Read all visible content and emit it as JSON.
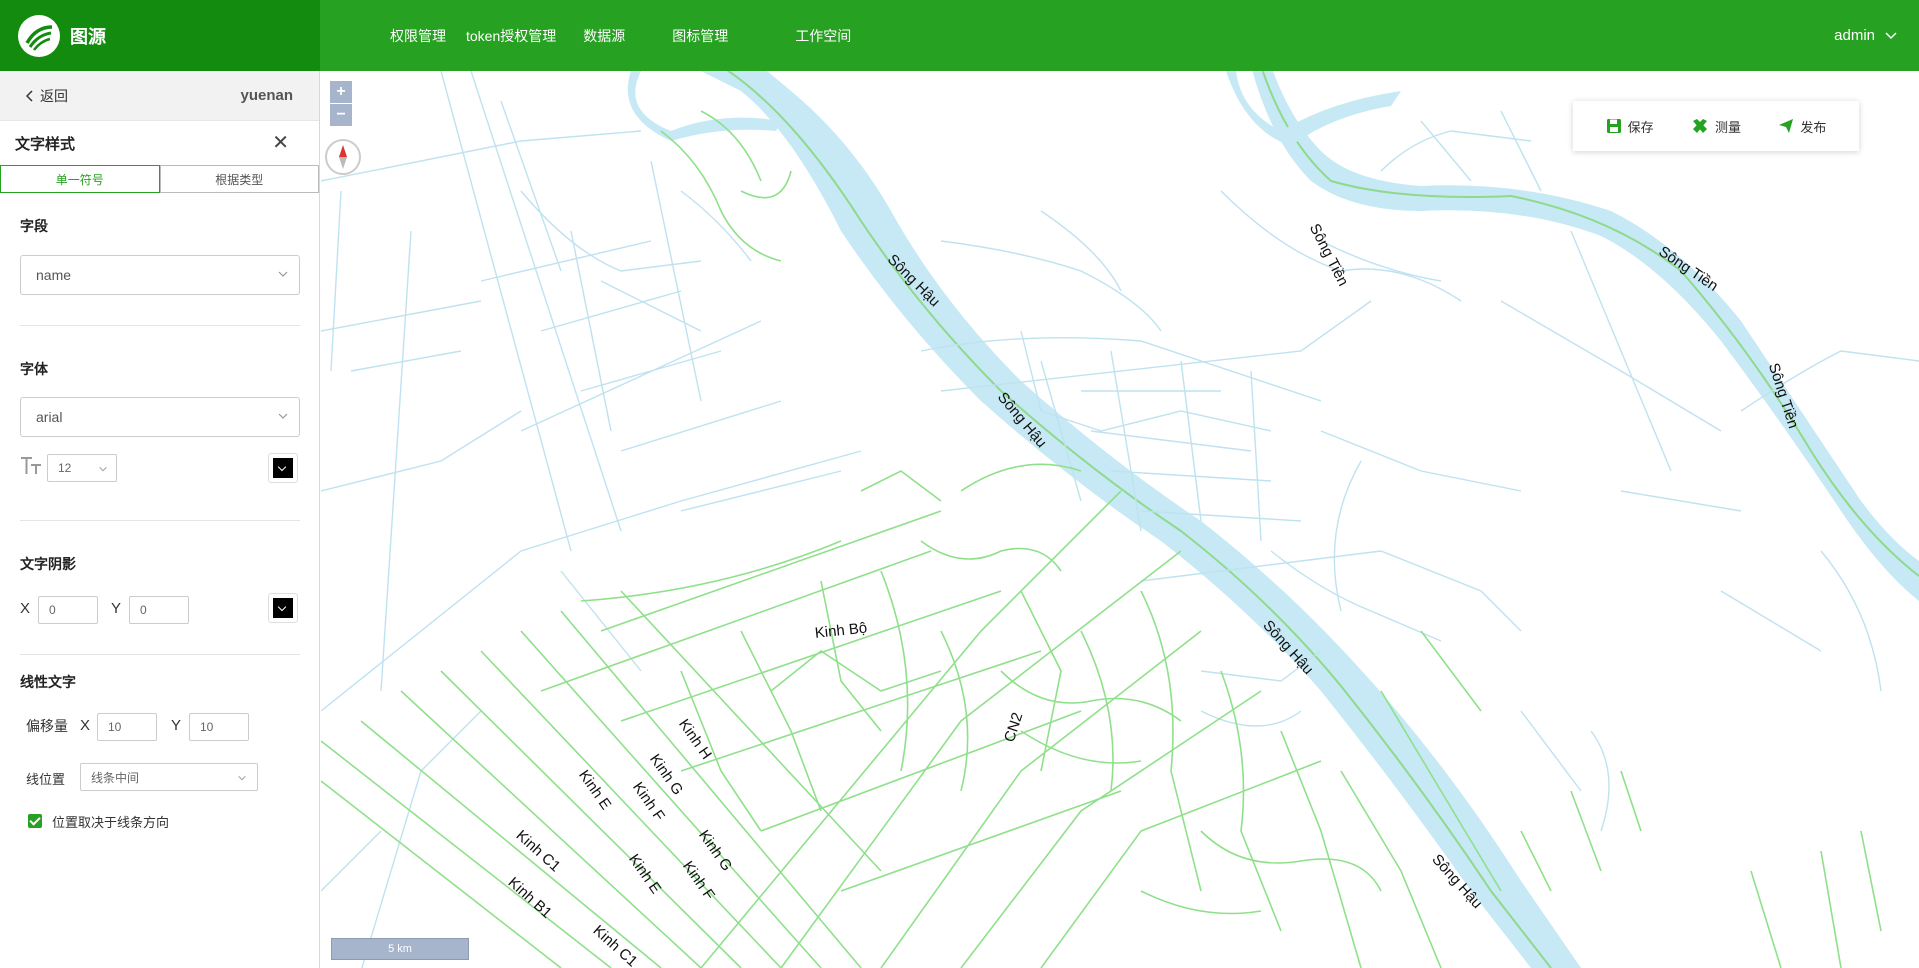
{
  "header": {
    "brand_name": "图源",
    "nav": [
      "权限管理",
      "token授权管理",
      "数据源",
      "图标管理",
      "工作空间"
    ],
    "user": "admin"
  },
  "sidebar": {
    "back_label": "返回",
    "project_name": "yuenan",
    "panel_title": "文字样式",
    "tabs": [
      "单一符号",
      "根据类型"
    ],
    "field": {
      "label": "字段",
      "value": "name"
    },
    "font": {
      "label": "字体",
      "value": "arial",
      "size": "12",
      "color": "#000000"
    },
    "shadow": {
      "label": "文字阴影",
      "x_label": "X",
      "x_value": "0",
      "y_label": "Y",
      "y_value": "0",
      "color": "#000000"
    },
    "linear": {
      "label": "线性文字",
      "offset_label": "偏移量",
      "x_label": "X",
      "x_value": "10",
      "y_label": "Y",
      "y_value": "10",
      "position_label": "线位置",
      "position_value": "线条中间",
      "checkbox_label": "位置取决于线条方向",
      "checkbox_checked": true
    }
  },
  "map": {
    "zoom_in": "+",
    "zoom_out": "−",
    "scale_label": "5 km",
    "toolbar": {
      "save": "保存",
      "measure": "测量",
      "publish": "发布"
    },
    "labels": [
      {
        "text": "Sông Tiền"
      },
      {
        "text": "Sông Tiền"
      },
      {
        "text": "Sông Tiền"
      },
      {
        "text": "Sông Hậu"
      },
      {
        "text": "Sông Hậu"
      },
      {
        "text": "Sông Hậu"
      },
      {
        "text": "Sông Hậu"
      },
      {
        "text": "Kinh Bộ"
      },
      {
        "text": "CN2"
      },
      {
        "text": "Kinh H"
      },
      {
        "text": "Kinh G"
      },
      {
        "text": "Kinh G"
      },
      {
        "text": "Kinh F"
      },
      {
        "text": "Kinh F"
      },
      {
        "text": "Kinh E"
      },
      {
        "text": "Kinh E"
      },
      {
        "text": "Kinh C1"
      },
      {
        "text": "Kinh B1"
      },
      {
        "text": "Kinh C1"
      }
    ],
    "colors": {
      "water": "#c6e9f5",
      "river_line": "#8fd98b",
      "canal": "#bfe2f0",
      "road": "#8fe08a"
    }
  }
}
